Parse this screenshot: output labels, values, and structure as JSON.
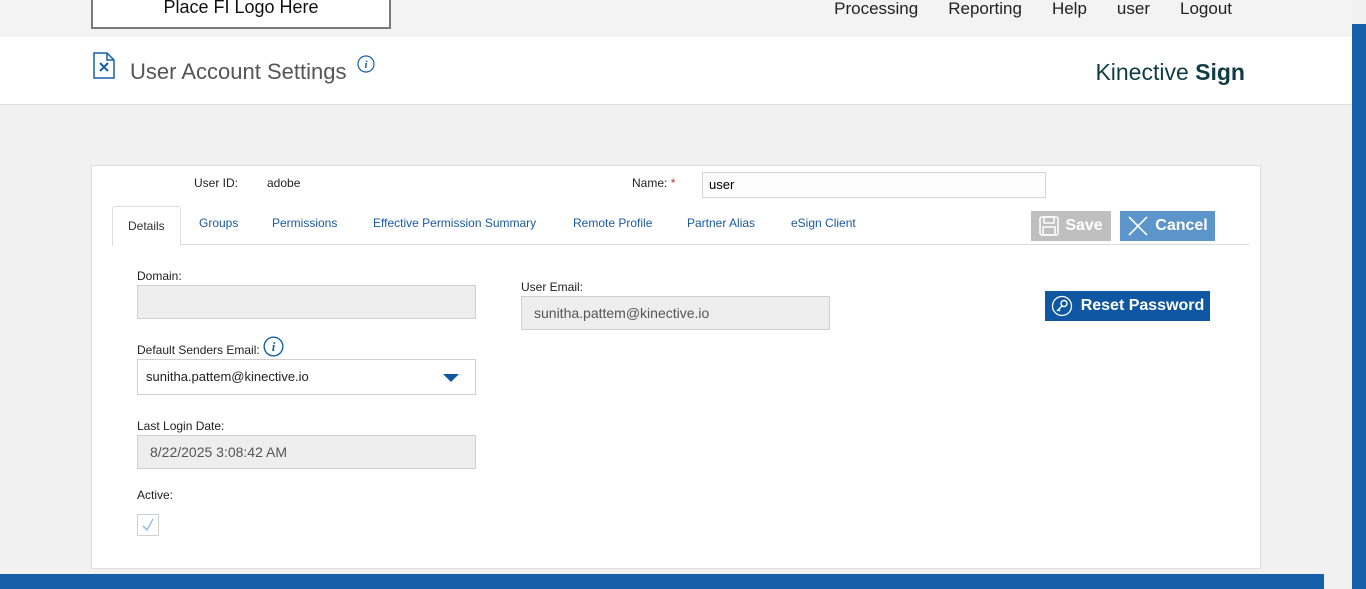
{
  "topbar": {
    "logo_text": "Place FI Logo Here",
    "nav": [
      "Processing",
      "Reporting",
      "Help",
      "user",
      "Logout"
    ]
  },
  "header": {
    "title": "User Account Settings",
    "brand_light": "Kinective",
    "brand_bold": "Sign"
  },
  "form": {
    "user_id_label": "User ID:",
    "user_id_value": "adobe",
    "name_label": "Name:",
    "name_required_mark": "*",
    "name_value": "user",
    "tabs": [
      "Details",
      "Groups",
      "Permissions",
      "Effective Permission Summary",
      "Remote Profile",
      "Partner Alias",
      "eSign Client"
    ],
    "save_label": "Save",
    "cancel_label": "Cancel",
    "domain_label": "Domain:",
    "domain_value": "",
    "default_senders_email_label": "Default Senders Email:",
    "default_senders_email_value": "sunitha.pattem@kinective.io",
    "last_login_label": "Last Login Date:",
    "last_login_value": "8/22/2025 3:08:42 AM",
    "active_label": "Active:",
    "active_checked": true,
    "user_email_label": "User Email:",
    "user_email_value": "sunitha.pattem@kinective.io",
    "reset_password_label": "Reset Password"
  },
  "colors": {
    "accent": "#0f57a2",
    "cancel": "#5b95c9",
    "save_disabled": "#bfbfbf",
    "brand_text": "#103d44"
  }
}
